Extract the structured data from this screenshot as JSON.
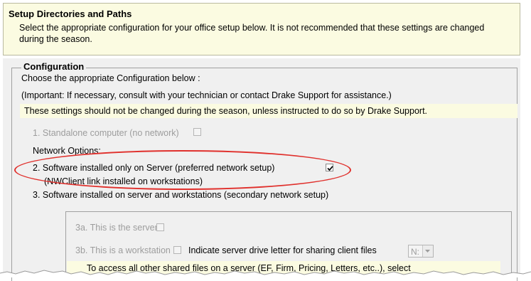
{
  "header": {
    "title": "Setup Directories and Paths",
    "description": "Select the appropriate configuration for your office setup below. It is not recommended that these settings are changed during the season."
  },
  "configuration": {
    "group_title": "Configuration",
    "intro": "Choose the appropriate Configuration below :",
    "important": "(Important: If necessary, consult with your technician or contact Drake Support for assistance.)",
    "warning": "These settings should not be changed during the season, unless instructed to do so by Drake Support.",
    "option1": {
      "label": "1. Standalone computer (no network)",
      "checked": false,
      "enabled": false
    },
    "network_options_label": "Network Options:",
    "option2": {
      "label": "2.  Software installed only on Server (preferred network setup)",
      "sublabel": "(NWClient link installed on workstations)",
      "checked": true,
      "highlighted": true,
      "highlight_color": "#e0302c"
    },
    "option3": {
      "label": "3.  Software installed on server and workstations (secondary network setup)",
      "sub3a": {
        "label": "3a.  This is the server",
        "checked": false,
        "enabled": false
      },
      "sub3b": {
        "label": "3b.  This is a workstation",
        "checked": false,
        "enabled": false,
        "drive_letter_label": "Indicate server drive letter for sharing client files",
        "drive_letter_value": "N:"
      },
      "shared_files_note": "To access all other shared files on a server (EF, Firm, Pricing, Letters, etc..), select"
    }
  },
  "colors": {
    "header_bg": "#fbfbe1",
    "panel_bg": "#f0f0f0",
    "highlight": "#e0302c",
    "disabled_text": "#9d9d9d"
  }
}
